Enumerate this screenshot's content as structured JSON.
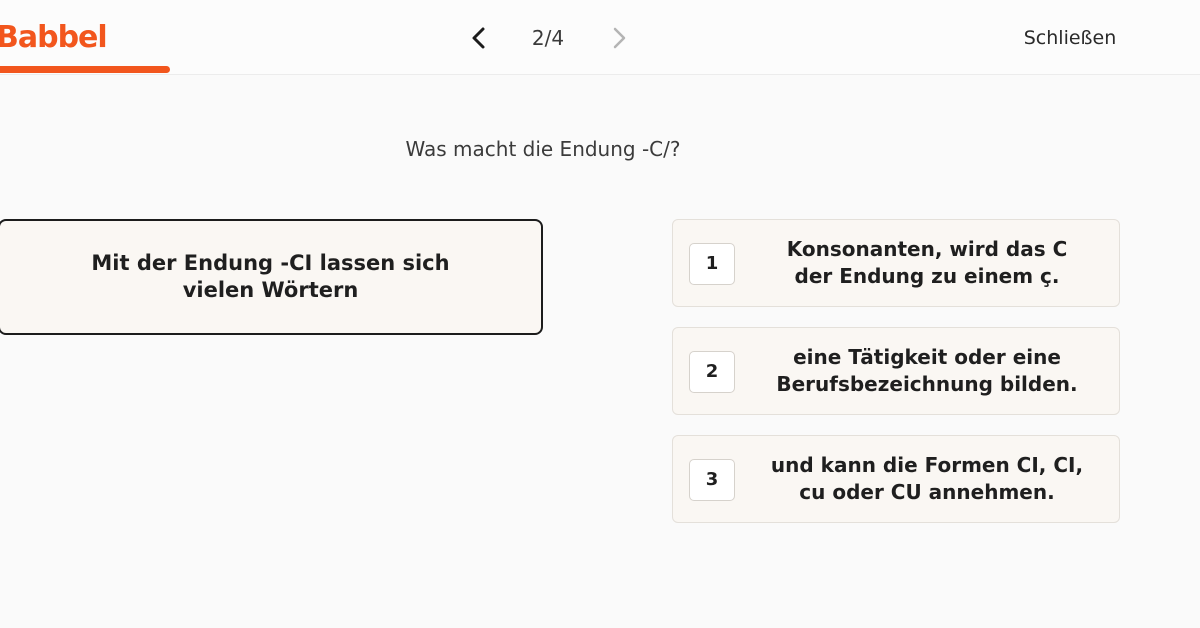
{
  "header": {
    "logo": "Babbel",
    "page_indicator": "2/4",
    "close_label": "Schließen",
    "progress": 0.142,
    "accent_color": "#f2561d",
    "prev_icon": "chevron-left-icon",
    "next_icon": "chevron-right-icon"
  },
  "question": "Was macht die Endung -C/?",
  "prompt": {
    "line1": "Mit der Endung -CI lassen sich",
    "line2": "vielen Wörtern"
  },
  "options": [
    {
      "number": "1",
      "line1": "Konsonanten, wird das C",
      "line2": "der Endung zu einem ç."
    },
    {
      "number": "2",
      "line1": "eine Tätigkeit oder eine",
      "line2": "Berufsbezeichnung bilden."
    },
    {
      "number": "3",
      "line1": "und kann die Formen CI, CI,",
      "line2": "cu oder CU annehmen."
    }
  ]
}
